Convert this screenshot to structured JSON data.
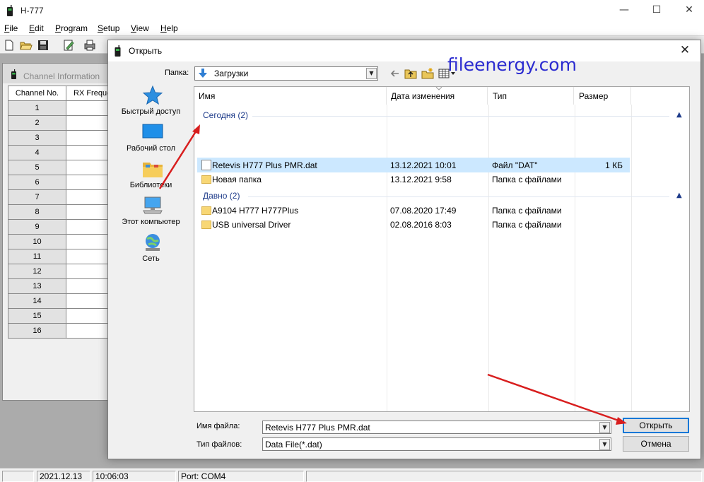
{
  "app": {
    "title": "H-777",
    "window_controls": {
      "minimize": "—",
      "maximize": "☐",
      "close": "✕"
    }
  },
  "menubar": {
    "items": [
      {
        "hotkey": "F",
        "rest": "ile"
      },
      {
        "hotkey": "E",
        "rest": "dit"
      },
      {
        "hotkey": "P",
        "rest": "rogram"
      },
      {
        "hotkey": "S",
        "rest": "etup"
      },
      {
        "hotkey": "V",
        "rest": "iew"
      },
      {
        "hotkey": "H",
        "rest": "elp"
      }
    ]
  },
  "toolbar": {
    "icons": [
      "new-file-icon",
      "open-folder-icon",
      "save-icon",
      "edit-icon",
      "print-icon"
    ]
  },
  "channel_window": {
    "title": "Channel Information",
    "columns": [
      "Channel No.",
      "RX Freque"
    ],
    "rows": [
      "1",
      "2",
      "3",
      "4",
      "5",
      "6",
      "7",
      "8",
      "9",
      "10",
      "11",
      "12",
      "13",
      "14",
      "15",
      "16"
    ]
  },
  "statusbar": {
    "date": "2021.12.13",
    "time": "10:06:03",
    "port": "Port: COM4"
  },
  "dialog": {
    "title": "Открыть",
    "close": "✕",
    "lookin_label": "Папка:",
    "lookin_value": "Загрузки",
    "watermark": "fileenergy.com",
    "places": [
      {
        "label": "Быстрый доступ",
        "icon": "star-icon"
      },
      {
        "label": "Рабочий стол",
        "icon": "desktop-icon"
      },
      {
        "label": "Библиотеки",
        "icon": "libraries-icon"
      },
      {
        "label": "Этот компьютер",
        "icon": "computer-icon"
      },
      {
        "label": "Сеть",
        "icon": "network-icon"
      }
    ],
    "columns": {
      "name": "Имя",
      "modified": "Дата изменения",
      "type": "Тип",
      "size": "Размер"
    },
    "groups": [
      {
        "label": "Сегодня (2)",
        "files": [
          {
            "name": "Retevis H777 Plus PMR.dat",
            "modified": "13.12.2021 10:01",
            "type": "Файл \"DAT\"",
            "size": "1 КБ",
            "kind": "file",
            "selected": true
          },
          {
            "name": "Новая папка",
            "modified": "13.12.2021 9:58",
            "type": "Папка с файлами",
            "size": "",
            "kind": "folder",
            "selected": false
          }
        ]
      },
      {
        "label": "Давно (2)",
        "files": [
          {
            "name": "A9104 H777 H777Plus",
            "modified": "07.08.2020 17:49",
            "type": "Папка с файлами",
            "size": "",
            "kind": "folder",
            "selected": false
          },
          {
            "name": "USB universal Driver",
            "modified": "02.08.2016 8:03",
            "type": "Папка с файлами",
            "size": "",
            "kind": "folder",
            "selected": false
          }
        ]
      }
    ],
    "filename_label": "Имя файла:",
    "filename_value": "Retevis H777 Plus PMR.dat",
    "filetype_label": "Тип файлов:",
    "filetype_value": "Data File(*.dat)",
    "open_button": "Открыть",
    "cancel_button": "Отмена"
  },
  "colors": {
    "selection": "#cce8ff",
    "group_header": "#1e3b8a",
    "watermark": "#2b2bd0",
    "annotation_arrow": "#d81e1e",
    "default_button_border": "#0078d7"
  }
}
